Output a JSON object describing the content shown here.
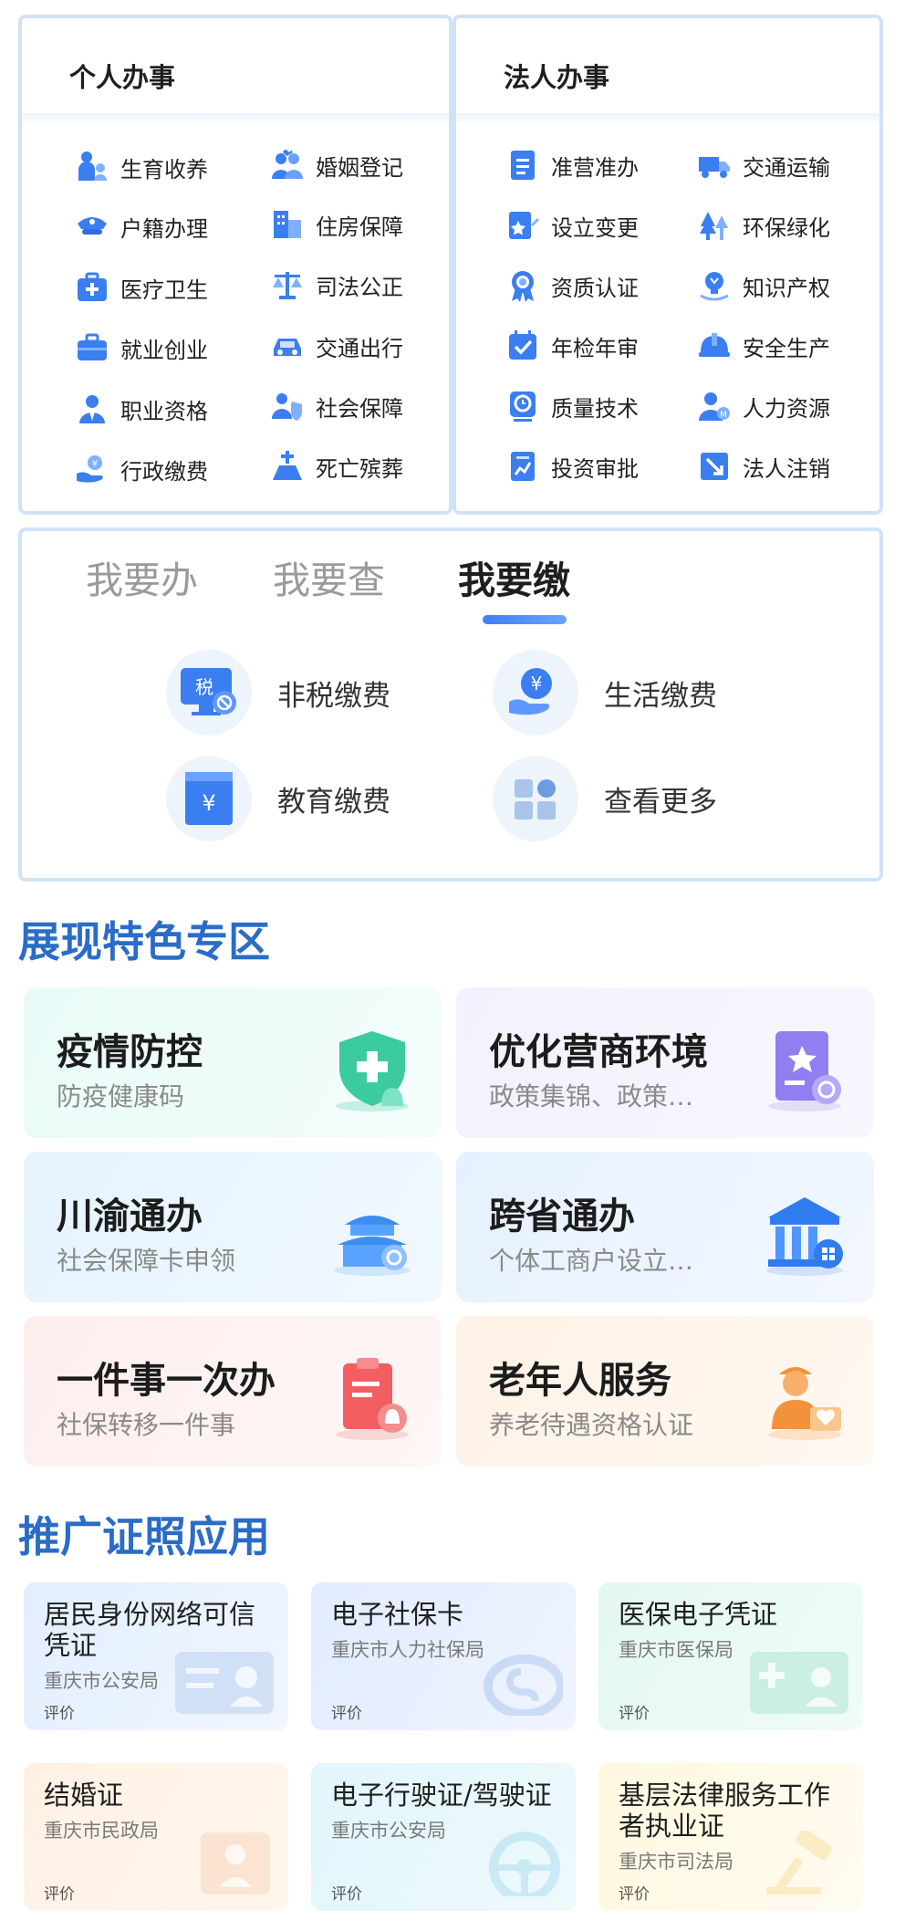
{
  "personal": {
    "title": "个人办事",
    "items": [
      {
        "label": "生育收养",
        "icon": "family-icon"
      },
      {
        "label": "婚姻登记",
        "icon": "couple-icon"
      },
      {
        "label": "户籍办理",
        "icon": "police-cap-icon"
      },
      {
        "label": "住房保障",
        "icon": "building-icon"
      },
      {
        "label": "医疗卫生",
        "icon": "medical-kit-icon"
      },
      {
        "label": "司法公正",
        "icon": "scales-icon"
      },
      {
        "label": "就业创业",
        "icon": "briefcase-icon"
      },
      {
        "label": "交通出行",
        "icon": "car-icon"
      },
      {
        "label": "职业资格",
        "icon": "worker-icon"
      },
      {
        "label": "社会保障",
        "icon": "shield-person-icon"
      },
      {
        "label": "行政缴费",
        "icon": "hand-coin-icon"
      },
      {
        "label": "死亡殡葬",
        "icon": "tomb-icon"
      }
    ]
  },
  "legal": {
    "title": "法人办事",
    "items": [
      {
        "label": "准营准办",
        "icon": "document-icon"
      },
      {
        "label": "交通运输",
        "icon": "truck-icon"
      },
      {
        "label": "设立变更",
        "icon": "edit-document-icon"
      },
      {
        "label": "环保绿化",
        "icon": "trees-icon"
      },
      {
        "label": "资质认证",
        "icon": "medal-icon"
      },
      {
        "label": "知识产权",
        "icon": "lightbulb-icon"
      },
      {
        "label": "年检年审",
        "icon": "checkbox-icon"
      },
      {
        "label": "安全生产",
        "icon": "helmet-icon"
      },
      {
        "label": "质量技术",
        "icon": "quality-icon"
      },
      {
        "label": "人力资源",
        "icon": "person-badge-icon"
      },
      {
        "label": "投资审批",
        "icon": "chart-document-icon"
      },
      {
        "label": "法人注销",
        "icon": "cancel-arrow-icon"
      }
    ]
  },
  "tabs": {
    "items": [
      "我要办",
      "我要查",
      "我要缴"
    ],
    "active": "我要缴",
    "payments": [
      {
        "label": "非税缴费",
        "icon": "tax-monitor-icon",
        "badge": "税"
      },
      {
        "label": "生活缴费",
        "icon": "hand-yuan-icon",
        "badge": "¥"
      },
      {
        "label": "教育缴费",
        "icon": "book-yuan-icon",
        "badge": "¥"
      },
      {
        "label": "查看更多",
        "icon": "grid-more-icon"
      }
    ]
  },
  "features": {
    "title": "展现特色专区",
    "cards": [
      {
        "title": "疫情防控",
        "subtitle": "防疫健康码",
        "icon": "health-shield-icon"
      },
      {
        "title": "优化营商环境",
        "subtitle": "政策集锦、政策…",
        "icon": "policy-star-icon"
      },
      {
        "title": "川渝通办",
        "subtitle": "社会保障卡申领",
        "icon": "temple-icon"
      },
      {
        "title": "跨省通办",
        "subtitle": "个体工商户设立…",
        "icon": "government-building-icon"
      },
      {
        "title": "一件事一次办",
        "subtitle": "社保转移一件事",
        "icon": "clipboard-bell-icon"
      },
      {
        "title": "老年人服务",
        "subtitle": "养老待遇资格认证",
        "icon": "elderly-heart-icon"
      }
    ]
  },
  "licenses": {
    "title": "推广证照应用",
    "review_label": "评价",
    "cards": [
      {
        "title": "居民身份网络可信凭证",
        "org": "重庆市公安局",
        "icon": "id-card-icon"
      },
      {
        "title": "电子社保卡",
        "org": "重庆市人力社保局",
        "icon": "social-security-logo-icon"
      },
      {
        "title": "医保电子凭证",
        "org": "重庆市医保局",
        "icon": "medical-insurance-card-icon"
      },
      {
        "title": "结婚证",
        "org": "重庆市民政局",
        "icon": "marriage-icon"
      },
      {
        "title": "电子行驶证/驾驶证",
        "org": "重庆市公安局",
        "icon": "steering-wheel-icon"
      },
      {
        "title": "基层法律服务工作者执业证",
        "org": "重庆市司法局",
        "icon": "gavel-icon"
      }
    ]
  },
  "colors": {
    "accent": "#3a7ef0",
    "section_title": "#2a6cc8",
    "panel_border": "#cfe3f8"
  }
}
